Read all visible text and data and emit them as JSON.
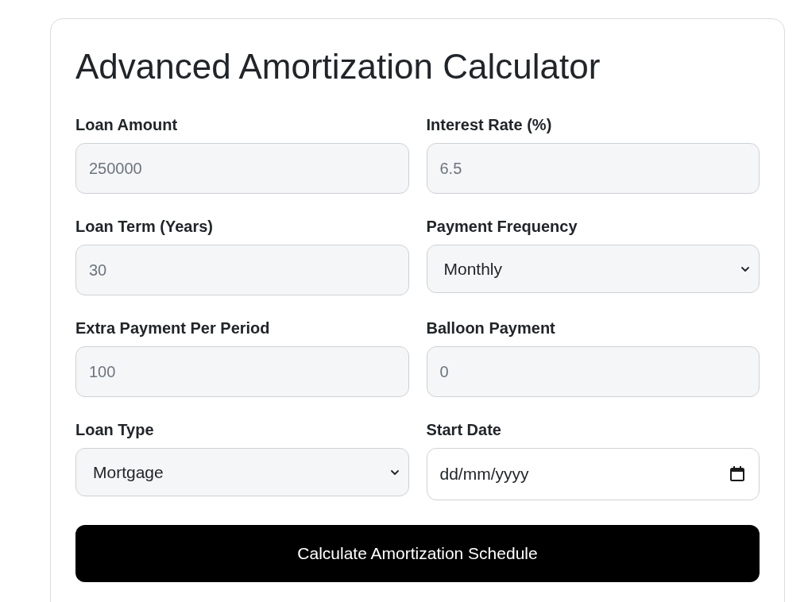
{
  "title": "Advanced Amortization Calculator",
  "fields": [
    {
      "kind": "number",
      "label": "Loan Amount",
      "placeholder": "250000"
    },
    {
      "kind": "number",
      "label": "Interest Rate (%)",
      "placeholder": "6.5"
    },
    {
      "kind": "number",
      "label": "Loan Term (Years)",
      "placeholder": "30"
    },
    {
      "kind": "select",
      "label": "Payment Frequency",
      "value": "Monthly"
    },
    {
      "kind": "number",
      "label": "Extra Payment Per Period",
      "placeholder": "100"
    },
    {
      "kind": "number",
      "label": "Balloon Payment",
      "placeholder": "0"
    },
    {
      "kind": "select",
      "label": "Loan Type",
      "value": "Mortgage"
    },
    {
      "kind": "date",
      "label": "Start Date",
      "placeholder": "dd/mm/yyyy"
    }
  ],
  "submit_button": "Calculate Amortization Schedule"
}
